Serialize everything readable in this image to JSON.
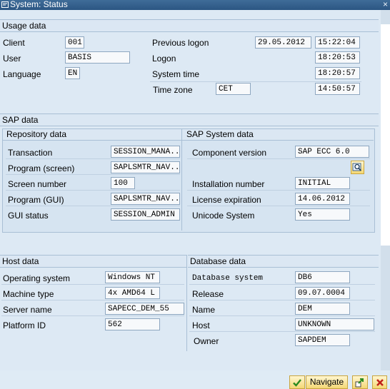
{
  "window": {
    "title": "System: Status",
    "close_glyph": "×"
  },
  "usage": {
    "header": "Usage data",
    "client_label": "Client",
    "client_value": "001",
    "user_label": "User",
    "user_value": "BASIS",
    "language_label": "Language",
    "language_value": "EN",
    "previous_logon_label": "Previous logon",
    "previous_logon_date": "29.05.2012",
    "previous_logon_time": "15:22:04",
    "logon_label": "Logon",
    "logon_time": "18:20:53",
    "system_time_label": "System time",
    "system_time": "18:20:57",
    "time_zone_label": "Time zone",
    "time_zone_value": "CET",
    "time_zone_time": "14:50:57"
  },
  "sap": {
    "header": "SAP data",
    "repository": {
      "header": "Repository data",
      "rows": [
        {
          "label": "Transaction",
          "value": "SESSION_MANA..."
        },
        {
          "label": "Program (screen)",
          "value": "SAPLSMTR_NAV..."
        },
        {
          "label": "Screen number",
          "value": "100"
        },
        {
          "label": "Program (GUI)",
          "value": "SAPLSMTR_NAV..."
        },
        {
          "label": "GUI status",
          "value": "SESSION_ADMIN"
        }
      ]
    },
    "system": {
      "header": "SAP System data",
      "component_version_label": "Component version",
      "component_version_value": "SAP ECC 6.0",
      "installation_number_label": "Installation number",
      "installation_number_value": "INITIAL",
      "license_expiration_label": "License expiration",
      "license_expiration_value": "14.06.2012",
      "unicode_system_label": "Unicode System",
      "unicode_system_value": "Yes",
      "detail_icon": "magnifier-detail-icon"
    }
  },
  "host": {
    "header": "Host data",
    "operating_system_label": "Operating system",
    "operating_system_value": "Windows NT",
    "machine_type_label": "Machine type",
    "machine_type_value": "4x AMD64 L",
    "server_name_label": "Server name",
    "server_name_value": "SAPECC_DEM_55",
    "platform_id_label": "Platform ID",
    "platform_id_value": "562"
  },
  "database": {
    "header": "Database data",
    "database_system_label": "Database system",
    "database_system_value": "DB6",
    "release_label": "Release",
    "release_value": "09.07.0004",
    "name_label": "Name",
    "name_value": "DEM",
    "host_label": "Host",
    "host_value": "UNKNOWN",
    "owner_label": "Owner",
    "owner_value": "SAPDEM"
  },
  "footer": {
    "ok_icon": "check-icon",
    "navigate_label": "Navigate",
    "export_icon": "arrow-export-icon",
    "cancel_icon": "cancel-x-icon"
  },
  "colors": {
    "titlebar": "#2c5683",
    "panel": "#dde9f4",
    "button": "#f4d774",
    "ok_green": "#2a8a1f",
    "cancel_red": "#c0201a"
  }
}
